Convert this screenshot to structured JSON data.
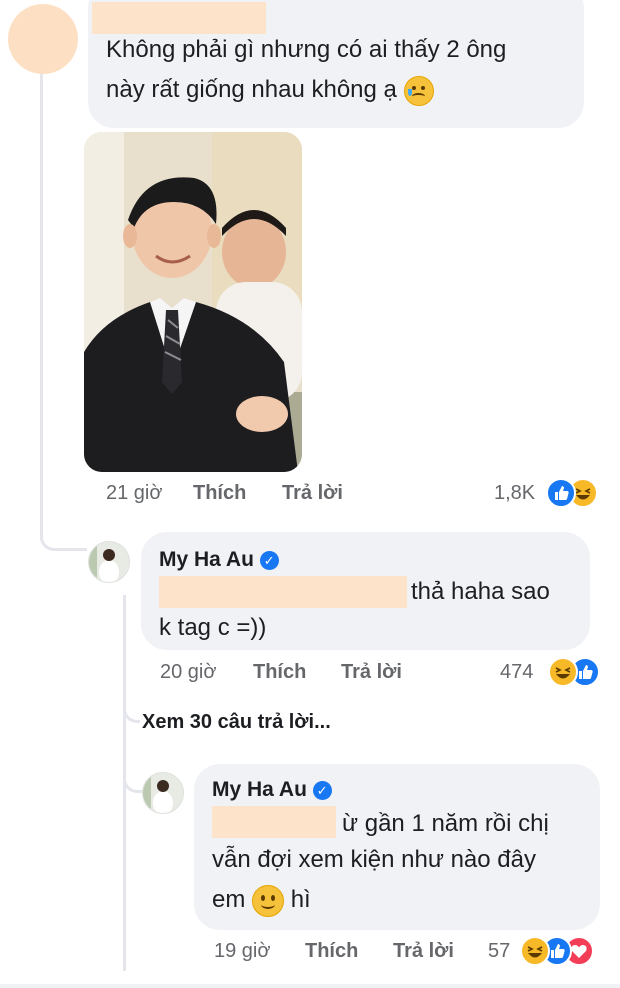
{
  "comment": {
    "text_line1": "Không phải gì nhưng có ai thấy 2 ông",
    "text_line2": "này rất giống nhau không ạ",
    "text_emoji": "crying-smile-emoji",
    "time": "21 giờ",
    "like": "Thích",
    "reply": "Trả lời",
    "reaction_count": "1,8K",
    "reactions": [
      "like",
      "haha"
    ]
  },
  "reply1": {
    "author": "My Ha Au",
    "text_line1_tail": "thả haha sao",
    "text_line2": "k tag c =))",
    "time": "20 giờ",
    "like": "Thích",
    "reply": "Trả lời",
    "reaction_count": "474",
    "reactions": [
      "haha",
      "like"
    ]
  },
  "view_more": "Xem 30 câu trả lời...",
  "reply2": {
    "author": "My Ha Au",
    "text_line1_tail": "ừ gần 1 năm rồi chị",
    "text_line2": "vẫn đợi xem kiện như nào đây",
    "text_line3_pre": "em",
    "text_line3_post": "hì",
    "text_emoji": "slight-smile-emoji",
    "time": "19 giờ",
    "like": "Thích",
    "reply": "Trả lời",
    "reaction_count": "57",
    "reactions": [
      "haha",
      "like",
      "love"
    ]
  },
  "colors": {
    "bubble": "#f0f2f5",
    "redaction": "#fde3c9",
    "meta_text": "#65676b",
    "like_blue": "#1877f2",
    "haha_yellow": "#f7b928",
    "love_red": "#f33e58"
  }
}
